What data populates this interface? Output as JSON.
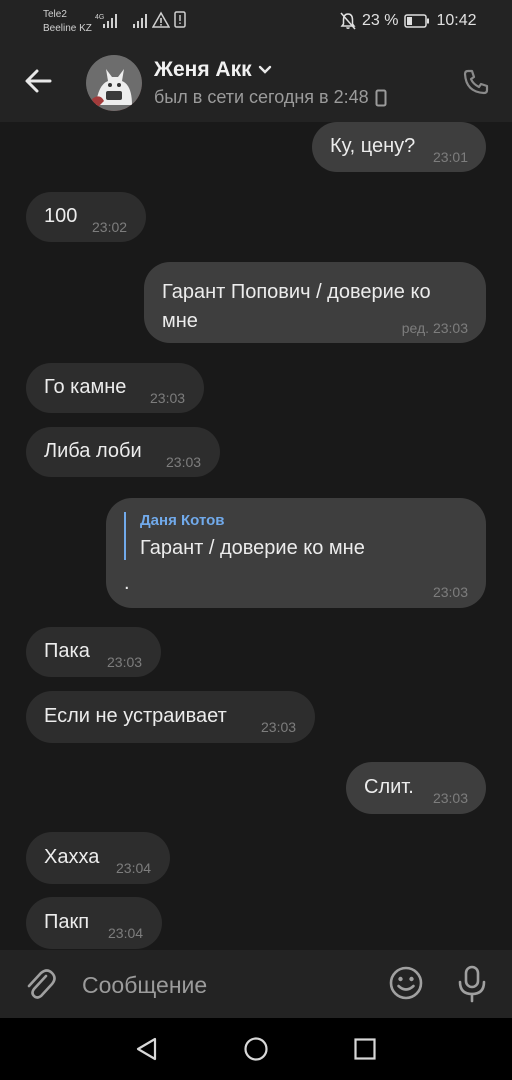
{
  "statusbar": {
    "carrier1": "Tele2",
    "carrier2": "Beeline KZ",
    "network_tag": "4G",
    "battery": "23 %",
    "time": "10:42"
  },
  "header": {
    "name": "Женя Акк",
    "last_seen": "был в сети сегодня в 2:48"
  },
  "messages": [
    {
      "dir": "out",
      "text": "Ку, цену?",
      "time": "23:01"
    },
    {
      "dir": "in",
      "text": "100",
      "time": "23:02"
    },
    {
      "dir": "out",
      "text_line1": "Гарант Попович / доверие ко",
      "text_line2": "мне",
      "time": "ред. 23:03"
    },
    {
      "dir": "in",
      "text": "Го камне",
      "time": "23:03"
    },
    {
      "dir": "in",
      "text": "Либа лоби",
      "time": "23:03"
    },
    {
      "dir": "out",
      "reply_author": "Даня Котов",
      "reply_text": "Гарант / доверие ко мне",
      "text": ".",
      "time": "23:03"
    },
    {
      "dir": "in",
      "text": "Пака",
      "time": "23:03"
    },
    {
      "dir": "in",
      "text": "Если не устраивает",
      "time": "23:03"
    },
    {
      "dir": "out",
      "text": "Слит.",
      "time": "23:03"
    },
    {
      "dir": "in",
      "text": "Хахха",
      "time": "23:04"
    },
    {
      "dir": "in",
      "text": "Пакп",
      "time": "23:04"
    }
  ],
  "composer": {
    "placeholder": "Сообщение"
  },
  "icons": {
    "back": "arrow-left-icon",
    "phone": "phone-icon",
    "attach": "paperclip-icon",
    "emoji": "smile-icon",
    "mic": "microphone-icon"
  },
  "colors": {
    "background": "#191919",
    "bar": "#232323",
    "bubble_in": "#2d2d2d",
    "bubble_out": "#3e3e3e",
    "accent": "#71aaeb"
  }
}
